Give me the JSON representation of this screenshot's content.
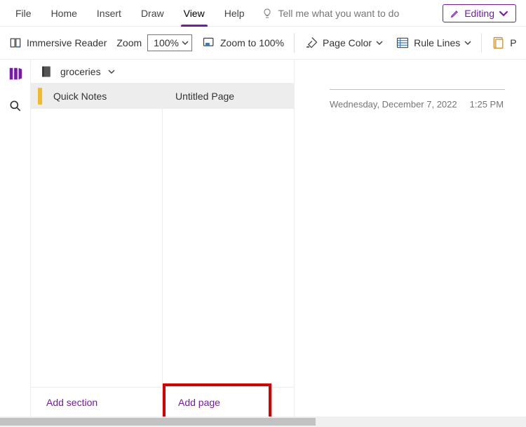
{
  "menu": {
    "file": "File",
    "home": "Home",
    "insert": "Insert",
    "draw": "Draw",
    "view": "View",
    "help": "Help",
    "tellme_placeholder": "Tell me what you want to do",
    "editing": "Editing"
  },
  "toolbar": {
    "immersive_reader": "Immersive Reader",
    "zoom_label": "Zoom",
    "zoom_value": "100%",
    "zoom_100": "Zoom to 100%",
    "page_color": "Page Color",
    "rule_lines": "Rule Lines",
    "paper_partial": "P"
  },
  "notebook": {
    "name": "groceries"
  },
  "sections": [
    {
      "label": "Quick Notes"
    }
  ],
  "pages": [
    {
      "label": "Untitled Page"
    }
  ],
  "nav_footer": {
    "add_section": "Add section",
    "add_page": "Add page"
  },
  "page_meta": {
    "date": "Wednesday, December 7, 2022",
    "time": "1:25 PM"
  }
}
